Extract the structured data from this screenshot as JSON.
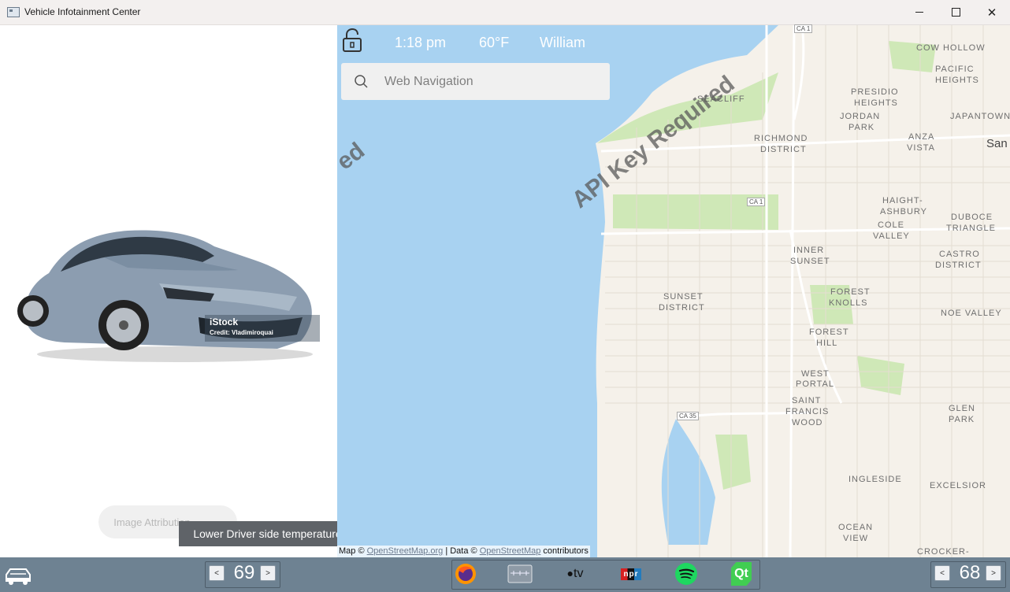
{
  "window": {
    "title": "Vehicle Infotainment Center"
  },
  "status": {
    "time": "1:18 pm",
    "temperature": "60°F",
    "user": "William"
  },
  "search": {
    "placeholder": "Web Navigation",
    "value": ""
  },
  "car_image": {
    "watermark_brand": "iStock",
    "watermark_credit": "Credit: Vladimiroquai"
  },
  "image_attribution": {
    "label": "Image Attribution"
  },
  "tooltip": {
    "text": "Lower Driver side temperature"
  },
  "map": {
    "watermark": "API Key Required",
    "watermark_fragment_left": "ed",
    "attribution": {
      "prefix": "Map ©",
      "link1": "OpenStreetMap.org",
      "middle": "| Data ©",
      "link2": "OpenStreetMap",
      "suffix": "contributors"
    },
    "labels": [
      {
        "text": "CA 1"
      },
      {
        "text": "COW HOLLOW"
      },
      {
        "text": "PACIFIC"
      },
      {
        "text": "HEIGHTS"
      },
      {
        "text": "SEACLIFF"
      },
      {
        "text": "PRESIDIO"
      },
      {
        "text": "HEIGHTS"
      },
      {
        "text": "JORDAN"
      },
      {
        "text": "PARK"
      },
      {
        "text": "JAPANTOWN"
      },
      {
        "text": "RICHMOND"
      },
      {
        "text": "DISTRICT"
      },
      {
        "text": "ANZA"
      },
      {
        "text": "VISTA"
      },
      {
        "text": "San"
      },
      {
        "text": "CA 1"
      },
      {
        "text": "HAIGHT-"
      },
      {
        "text": "ASHBURY"
      },
      {
        "text": "DUBOCE"
      },
      {
        "text": "TRIANGLE"
      },
      {
        "text": "COLE"
      },
      {
        "text": "VALLEY"
      },
      {
        "text": "INNER"
      },
      {
        "text": "SUNSET"
      },
      {
        "text": "CASTRO"
      },
      {
        "text": "DISTRICT"
      },
      {
        "text": "SUNSET"
      },
      {
        "text": "DISTRICT"
      },
      {
        "text": "FOREST"
      },
      {
        "text": "KNOLLS"
      },
      {
        "text": "NOE VALLEY"
      },
      {
        "text": "FOREST"
      },
      {
        "text": "HILL"
      },
      {
        "text": "WEST"
      },
      {
        "text": "PORTAL"
      },
      {
        "text": "SAINT"
      },
      {
        "text": "FRANCIS"
      },
      {
        "text": "WOOD"
      },
      {
        "text": "GLEN"
      },
      {
        "text": "PARK"
      },
      {
        "text": "CA 35"
      },
      {
        "text": "INGLESIDE"
      },
      {
        "text": "EXCELSIOR"
      },
      {
        "text": "OCEAN"
      },
      {
        "text": "VIEW"
      },
      {
        "text": "CROCKER-"
      }
    ]
  },
  "climate": {
    "driver_temp": "69",
    "passenger_temp": "68",
    "decrease_glyph": "<",
    "increase_glyph": ">"
  },
  "dock": {
    "apps": [
      {
        "name": "firefox"
      },
      {
        "name": "tuner"
      },
      {
        "name": "apple-tv",
        "label": "tv"
      },
      {
        "name": "npr",
        "label": "npr"
      },
      {
        "name": "spotify"
      },
      {
        "name": "qt",
        "label": "Qt"
      }
    ]
  },
  "colors": {
    "water": "#a8d2f1",
    "land": "#f5f1ea",
    "park": "#cfe8b7",
    "bar": "#6e8292"
  }
}
